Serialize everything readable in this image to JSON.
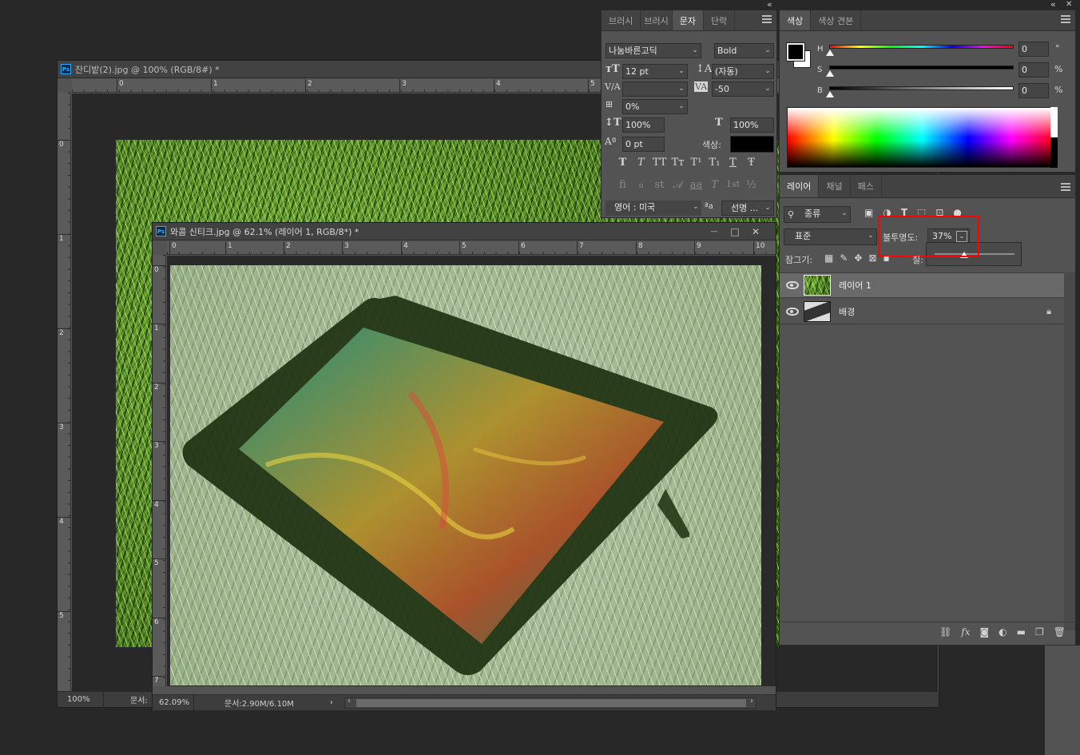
{
  "doc1": {
    "title": "잔디밭(2).jpg @ 100% (RGB/8#) *",
    "badge": "Ps",
    "ruler_h": [
      "0",
      "1",
      "2",
      "3",
      "4",
      "5"
    ],
    "ruler_v": [
      "0",
      "1",
      "2",
      "3",
      "4",
      "5"
    ],
    "status_zoom": "100%",
    "status_doc": "문서:"
  },
  "doc2": {
    "title": "와콤 신티크.jpg @ 62.1% (레이어 1, RGB/8*) *",
    "badge": "Ps",
    "ruler_h": [
      "0",
      "1",
      "2",
      "3",
      "4",
      "5",
      "6",
      "7",
      "8",
      "9",
      "10"
    ],
    "ruler_v": [
      "0",
      "1",
      "2",
      "3",
      "4",
      "5",
      "6",
      "7"
    ],
    "status_zoom": "62.09%",
    "status_doc": "문서:2.90M/6.10M",
    "status_arrow": "›",
    "scroll_left": "‹",
    "scroll_right": "›",
    "minimize": "—",
    "maximize": "□",
    "close": "✕"
  },
  "char_panel": {
    "tabs": [
      "브러시",
      "브러시",
      "문자",
      "단락"
    ],
    "active_tab": 2,
    "font_family": "나눔바른고딕",
    "font_style": "Bold",
    "font_size": "12 pt",
    "leading": "(자동)",
    "kerning": "",
    "tracking": "-50",
    "tsume": "0%",
    "vscale": "100%",
    "hscale": "100%",
    "baseline": "0 pt",
    "color_label": "색상:",
    "color_value": "#000000",
    "style_buttons": [
      "T",
      "T",
      "TT",
      "Tт",
      "T¹",
      "T₁",
      "T",
      "Ŧ"
    ],
    "opentype_buttons": [
      "fi",
      "ℴ",
      "st",
      "𝒜",
      "aa",
      "T",
      "1st",
      "½"
    ],
    "language": "영어 : 미국",
    "aa_icon": "ªa",
    "antialias": "선명 ..."
  },
  "color_panel": {
    "tabs": [
      "색상",
      "색상 견본"
    ],
    "active_tab": 0,
    "labels": [
      "H",
      "S",
      "B"
    ],
    "values": [
      "0",
      "0",
      "0"
    ],
    "units": [
      "°",
      "%",
      "%"
    ]
  },
  "layers_panel": {
    "tabs": [
      "레이어",
      "채널",
      "패스"
    ],
    "active_tab": 0,
    "filter_kind": "종류",
    "blend_mode": "표준",
    "opacity_label": "불투명도:",
    "opacity_value": "37%",
    "opacity_fraction": 0.37,
    "lock_label": "잠그기:",
    "fill_label": "칠:",
    "layers": [
      {
        "name": "레이어 1",
        "selected": true,
        "locked": false
      },
      {
        "name": "배경",
        "selected": false,
        "locked": true
      }
    ],
    "bottom_icons": [
      "link-icon",
      "fx-icon",
      "mask-icon",
      "adjustment-icon",
      "folder-icon",
      "new-layer-icon",
      "trash-icon"
    ],
    "fx_label": "fx"
  },
  "collapse_glyph": "«",
  "close_glyph": "✕",
  "highlight_color": "#ff0000"
}
